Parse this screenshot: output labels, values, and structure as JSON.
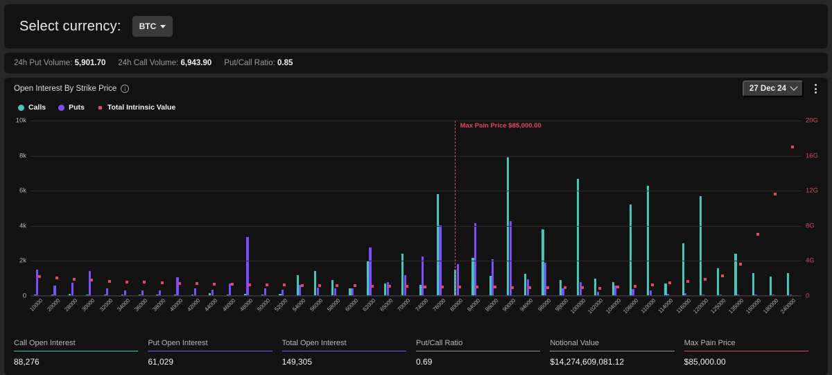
{
  "currency_bar": {
    "label": "Select currency:",
    "selected": "BTC"
  },
  "volume_bar": {
    "put_volume_label": "24h Put Volume:",
    "put_volume_value": "5,901.70",
    "call_volume_label": "24h Call Volume:",
    "call_volume_value": "6,943.90",
    "put_call_ratio_label": "Put/Call Ratio:",
    "put_call_ratio_value": "0.85"
  },
  "chart_header": {
    "title": "Open Interest By Strike Price",
    "info_icon": "info-icon",
    "expiry": "27 Dec 24",
    "menu_icon": "kebab-menu-icon"
  },
  "colors": {
    "calls": "#3ec9b8",
    "puts": "#7c4dff",
    "intrinsic": "#e8455f",
    "panel_bg": "#121212",
    "page_bg": "#272727"
  },
  "stats": [
    {
      "label": "Call Open Interest",
      "value": "88,276",
      "rule_color": "#3ec9b8"
    },
    {
      "label": "Put Open Interest",
      "value": "61,029",
      "rule_color": "#7c4dff"
    },
    {
      "label": "Total Open Interest",
      "value": "149,305",
      "rule_color": "#7c4dff"
    },
    {
      "label": "Put/Call Ratio",
      "value": "0.69",
      "rule_color": "#9a9a9a"
    },
    {
      "label": "Notional Value",
      "value": "$14,274,609,081.12",
      "rule_color": "#9a9a9a"
    },
    {
      "label": "Max Pain Price",
      "value": "$85,000.00",
      "rule_color": "#e8455f"
    }
  ],
  "chart_data": {
    "type": "bar",
    "title": "Open Interest By Strike Price",
    "xlabel": "",
    "ylabel": "Open Interest",
    "y2label": "Total Intrinsic Value",
    "ylim": [
      0,
      10000
    ],
    "y2lim": [
      0,
      20000000000
    ],
    "yticks": [
      "0",
      "2k",
      "4k",
      "6k",
      "8k",
      "10k"
    ],
    "ytick_values": [
      0,
      2000,
      4000,
      6000,
      8000,
      10000
    ],
    "y2ticks": [
      "0",
      "4G",
      "8G",
      "12G",
      "16G",
      "20G"
    ],
    "y2tick_values": [
      0,
      4000000000,
      8000000000,
      12000000000,
      16000000000,
      20000000000
    ],
    "grid": true,
    "legend_position": "top-left",
    "legend": [
      {
        "name": "Calls",
        "marker": "circle",
        "color": "#3ec9b8"
      },
      {
        "name": "Puts",
        "marker": "circle",
        "color": "#7c4dff"
      },
      {
        "name": "Total Intrinsic Value",
        "marker": "square",
        "color": "#e8455f"
      }
    ],
    "annotations": [
      {
        "type": "vline",
        "label": "Max Pain Price $85,000.00",
        "x": "85000",
        "color": "#e8455f",
        "style": "dashed"
      }
    ],
    "categories": [
      "10000",
      "20000",
      "28000",
      "30000",
      "32000",
      "34000",
      "36000",
      "38000",
      "40000",
      "42000",
      "44000",
      "46000",
      "48000",
      "50000",
      "52000",
      "54000",
      "56000",
      "58000",
      "60000",
      "62000",
      "65000",
      "70000",
      "74000",
      "76000",
      "80000",
      "84000",
      "86000",
      "90000",
      "94000",
      "96000",
      "98000",
      "100000",
      "102000",
      "104000",
      "106000",
      "110000",
      "114000",
      "116000",
      "120000",
      "125000",
      "135000",
      "150000",
      "180000",
      "240000"
    ],
    "series": [
      {
        "name": "Calls",
        "color": "#3ec9b8",
        "values": [
          40,
          30,
          120,
          60,
          40,
          60,
          80,
          40,
          90,
          70,
          150,
          60,
          110,
          80,
          130,
          1180,
          1420,
          900,
          420,
          1980,
          700,
          2400,
          640,
          5800,
          1500,
          2180,
          1160,
          7900,
          1250,
          3800,
          900,
          6700,
          1000,
          800,
          5200,
          6300,
          700,
          3000,
          5700,
          1600,
          2400,
          1300,
          1100,
          1300
        ]
      },
      {
        "name": "Puts",
        "color": "#7c4dff",
        "values": [
          1500,
          600,
          750,
          1420,
          420,
          330,
          330,
          330,
          1050,
          450,
          350,
          700,
          3350,
          430,
          360,
          620,
          480,
          430,
          450,
          2750,
          780,
          1200,
          2250,
          4050,
          1820,
          4150,
          2100,
          4250,
          950,
          1900,
          420,
          800,
          250,
          600,
          380,
          300,
          120,
          150,
          90,
          60,
          40,
          30,
          20,
          20
        ]
      }
    ],
    "intrinsic_value": {
      "name": "Total Intrinsic Value",
      "color": "#e8455f",
      "values": [
        2200000000,
        2050000000,
        1900000000,
        1800000000,
        1700000000,
        1620000000,
        1560000000,
        1500000000,
        1450000000,
        1420000000,
        1380000000,
        1340000000,
        1300000000,
        1270000000,
        1240000000,
        1220000000,
        1200000000,
        1180000000,
        1150000000,
        1120000000,
        1100000000,
        1080000000,
        1060000000,
        1050000000,
        1030000000,
        1020000000,
        1000000000,
        980000000,
        960000000,
        940000000,
        930000000,
        920000000,
        910000000,
        1000000000,
        1100000000,
        1300000000,
        1500000000,
        1700000000,
        1900000000,
        2300000000,
        3600000000,
        7000000000,
        11600000000,
        17000000000
      ]
    }
  }
}
